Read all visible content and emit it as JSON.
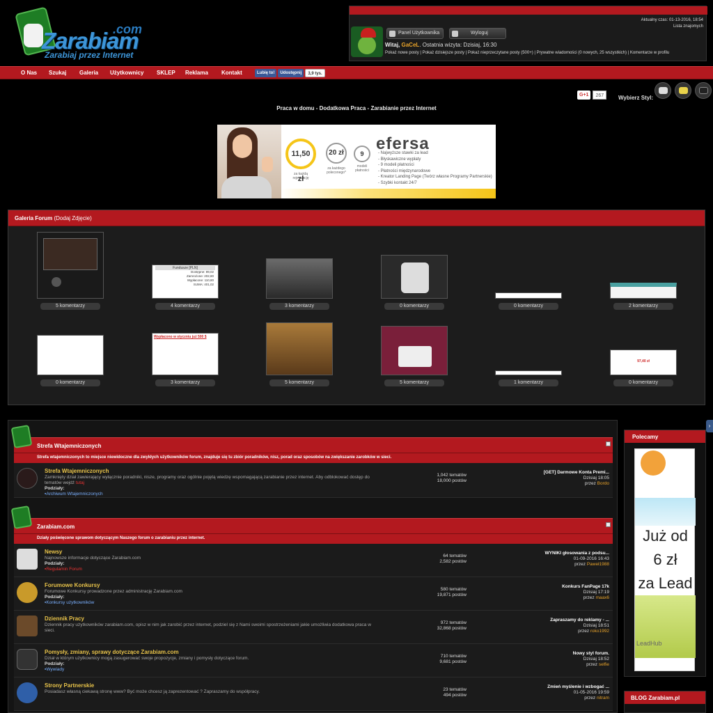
{
  "header": {
    "logo": {
      "name": "Zarabiam",
      "dotcom": ".com",
      "tagline": "Zarabiaj przez Internet"
    },
    "time_label": "Aktualny czas: 01-13-2016, 18:54",
    "friends_link": "Lista znajomych",
    "panel_button": "Panel Użytkownika",
    "logout_button": "Wyloguj",
    "welcome_prefix": "Witaj,",
    "username": "GaCeL",
    "last_visit": ". Ostatnia wizyta: Dzisiaj, 16:30",
    "quick_links": "Pokaż nowe posty | Pokaż dzisiejsze posty | Pokaż nieprzeczytane posty (500+) | Prywatne wiadomości (0 nowych, 25 wszystkich) | Komentarze w profilu"
  },
  "nav": {
    "items": [
      "O Nas",
      "Szukaj",
      "Galeria",
      "Użytkownicy",
      "SKLEP",
      "Reklama",
      "Kontakt"
    ],
    "fb_like": "Lubię to!",
    "fb_share": "Udostępnij",
    "fb_count": "3,9 tys."
  },
  "topright": {
    "gplus": "G+1",
    "gplus_count": "267",
    "style_label": "Wybierz Styl:"
  },
  "slogan": "Praca w domu - Dodatkowa Praca - Zarabianie przez Internet",
  "banner": {
    "logo": "efersa",
    "circle1": "11,50 zł",
    "circle1_sub": "za każdą rejestrację",
    "circle2": "20 zł",
    "circle2_sub": "za każdego poleconego*",
    "circle3": "9",
    "circle3_sub": "modeli płatności",
    "features": [
      "- Najwyższe stawki za lead",
      "- Błyskawiczne wypłaty",
      "- 9 modeli płatności",
      "- Płatności międzynarodowe",
      "- Kreator Landing Page (Twórz własne Programy Partnerskie)",
      "- Szybki kontakt 24/7"
    ]
  },
  "gallery": {
    "title": "Galeria Forum",
    "add": "(Dodaj Zdjęcie)",
    "row1": [
      "5 komentarzy",
      "4 komentarzy",
      "3 komentarzy",
      "0 komentarzy",
      "0 komentarzy",
      "2 komentarzy"
    ],
    "row2": [
      "0 komentarzy",
      "3 komentarzy",
      "5 komentarzy",
      "5 komentarzy",
      "1 komentarzy",
      "0 komentarzy"
    ],
    "thumb_text": {
      "fund_title": "Fundusze [PLN]",
      "fund_lines": [
        "Dostępne: 89,02",
        "Zamrożone: 202,80",
        "Wypłacone: 110,80",
        "SUMA: 401,02"
      ],
      "wyplacono": "Wypłacono w styczniu już 500 $",
      "amount": "97,40 zł"
    }
  },
  "forum": {
    "cat1": {
      "title": "Strefa Wtajemniczonych",
      "desc": "Strefa wtajemniczonych to miejsce niewidoczne dla zwykłych użytkowników forum, znajduje się tu zbiór poradników, nisz, porad oraz sposobów na zwiększanie zarobków w sieci.",
      "rows": [
        {
          "title": "Strefa Wtajemniczonych",
          "desc": "Zamknięty dział zawierający wyłącznie poradniki, nisze, programy oraz ogólnie pojętą wiedzę wspomagającą zarabianie przez internet. Aby odblokować dostęp do tematów wejdź",
          "desc_link": "tutaj",
          "sub_label": "Podziały:",
          "sub": "Archiwum Wtajemniczonych",
          "threads": "1,042 tematów",
          "posts": "18,000 postów",
          "last_title": "[GET] Darmowe Konta Premi...",
          "last_date": "Dzisiaj 18:05",
          "last_by": "przez",
          "last_user": "Bordo"
        }
      ]
    },
    "cat2": {
      "title": "Zarabiam.com",
      "desc": "Działy poświęcone sprawom dotyczącym Naszego forum o zarabianiu przez internet.",
      "rows": [
        {
          "title": "Newsy",
          "desc": "Najnowsze informacje dotyczące Zarabiam.com",
          "sub_label": "Podziały:",
          "sub": "Regulamin Forum",
          "threads": "64 tematów",
          "posts": "2,582 postów",
          "last_title": "WYNIKI głosowania z podsu...",
          "last_date": "01-09-2016 16:43",
          "last_by": "przez",
          "last_user": "Paweł1988"
        },
        {
          "title": "Forumowe Konkursy",
          "desc": "Forumowe Konkursy prowadzone przez administrację Zarabiam.com",
          "sub_label": "Podziały:",
          "sub": "Konkursy użytkowników",
          "threads": "580 tematów",
          "posts": "19,871 postów",
          "last_title": "Konkurs FanPage 17k",
          "last_date": "Dzisiaj 17:19",
          "last_by": "przez",
          "last_user": "maax6"
        },
        {
          "title": "Dziennik Pracy",
          "desc": "Dziennik pracy użytkowników zarabiam.com, opisz w nim jak zarobić przez internet, podziel się z Nami swoimi spostrzeżeniami jakie umożliwia dodatkowa praca w sieci.",
          "sub_label": "",
          "sub": "",
          "threads": "972 tematów",
          "posts": "32,868 postów",
          "last_title": "Zapraszamy do reklamy - ...",
          "last_date": "Dzisiaj 18:51",
          "last_by": "przez",
          "last_user": "roko1992"
        },
        {
          "title": "Pomysły, zmiany, sprawy dotyczące Zarabiam.com",
          "desc": "Dział w którym użytkownicy mogą zasugerować swoje propozycje, zmiany i pomysły dotyczące forum.",
          "sub_label": "Podziały:",
          "sub": "Wywiady",
          "threads": "710 tematów",
          "posts": "9,681 postów",
          "last_title": "Nowy styl forum.",
          "last_date": "Dzisiaj 18:52",
          "last_by": "przez",
          "last_user": "selfie"
        },
        {
          "title": "Strony Partnerskie",
          "desc": "Posiadasz własną ciekawą stronę www? Być może chcesz ją zaprezentować ? Zapraszamy do współpracy.",
          "sub_label": "",
          "sub": "",
          "threads": "23 tematów",
          "posts": "494 postów",
          "last_title": "Zmień myślenie i wzbogać ...",
          "last_date": "01-05-2016 19:59",
          "last_by": "przez",
          "last_user": "nitram"
        }
      ]
    }
  },
  "sidebar": {
    "polecamy": "Polecamy",
    "ad_line1": "Już od",
    "ad_line2": "6 zł",
    "ad_line3": "za Lead",
    "ad_brand": "LeadHub",
    "blog": "BLOG Zarabiam.pl"
  },
  "colors": {
    "accent": "#b3191f",
    "link": "#e8a32a",
    "logo": "#3d95d8",
    "background": "#000000"
  }
}
